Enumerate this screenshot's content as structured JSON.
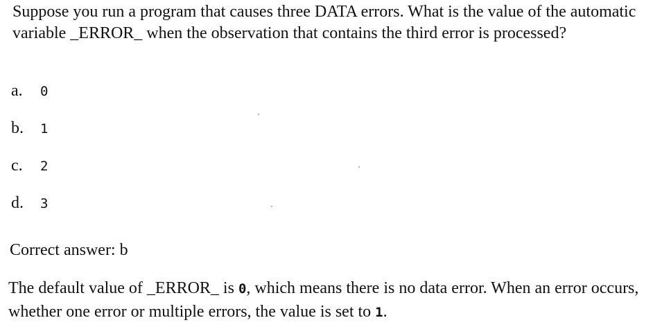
{
  "question": {
    "text": "Suppose you run a program that causes three DATA errors. What is the value of the automatic variable _ERROR_ when the observation that contains the third error is processed?"
  },
  "options": [
    {
      "letter": "a.",
      "value": "0"
    },
    {
      "letter": "b.",
      "value": "1"
    },
    {
      "letter": "c.",
      "value": "2"
    },
    {
      "letter": "d.",
      "value": "3"
    }
  ],
  "answer": {
    "text": "Correct answer: b"
  },
  "explanation": {
    "part1": "The default value of _ERROR_ is ",
    "code1": "0",
    "part2": ", which means there is no data error. When an error occurs, whether one error or multiple errors, the value is set to ",
    "code2": "1",
    "part3": "."
  }
}
